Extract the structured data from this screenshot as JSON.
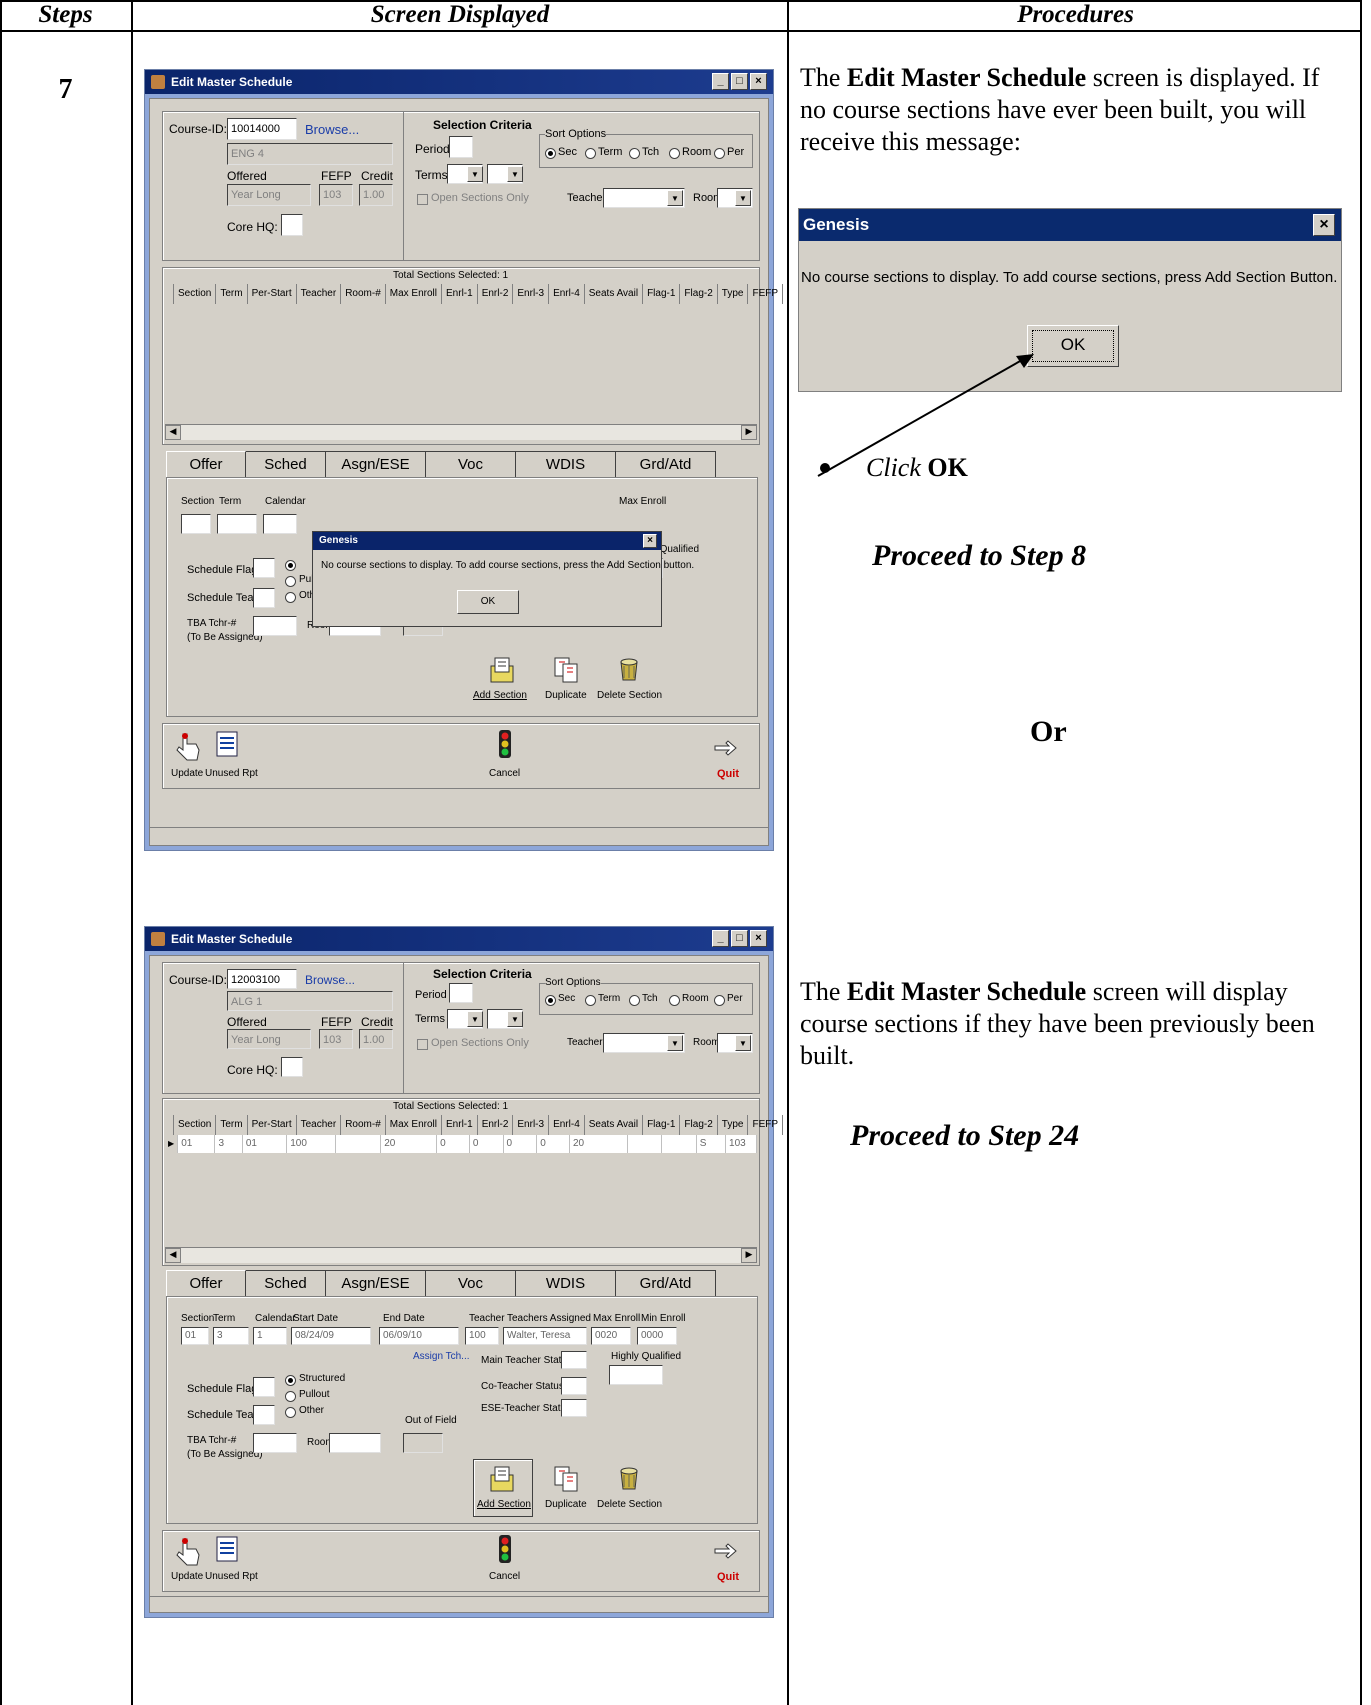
{
  "header": {
    "steps": "Steps",
    "screen": "Screen Displayed",
    "procedures": "Procedures"
  },
  "step_number": "7",
  "window_title": "Edit Master Schedule",
  "top_panel": {
    "course_id_label": "Course-ID:",
    "browse": "Browse...",
    "offered_label": "Offered",
    "fefp_label": "FEFP",
    "credit_label": "Credit",
    "core_hq_label": "Core HQ:",
    "selection_criteria": "Selection Criteria",
    "period_label": "Period",
    "terms_label": "Terms",
    "open_sections_only": "Open Sections Only",
    "sort_options": "Sort Options",
    "sort_sec": "Sec",
    "sort_term": "Term",
    "sort_tch": "Tch",
    "sort_room": "Room",
    "sort_per": "Per",
    "teacher_label": "Teacher",
    "room_label": "Room"
  },
  "grid_columns": [
    "Section",
    "Term",
    "Per-Start",
    "Teacher",
    "Room-#",
    "Max Enroll",
    "Enrl-1",
    "Enrl-2",
    "Enrl-3",
    "Enrl-4",
    "Seats Avail",
    "Flag-1",
    "Flag-2",
    "Type",
    "FEFP"
  ],
  "tabs": [
    "Offer",
    "Sched",
    "Asgn/ESE",
    "Voc",
    "WDIS",
    "Grd/Atd"
  ],
  "offer_panel": {
    "section": "Section",
    "term": "Term",
    "calendar": "Calendar",
    "start_date": "Start Date",
    "end_date": "End Date",
    "teacher": "Teacher",
    "teachers_assigned": "Teachers Assigned",
    "max_enroll": "Max Enroll",
    "min_enroll": "Min Enroll",
    "highly_qualified": "Highly Qualified",
    "assign_tch": "Assign Tch...",
    "main_teacher_status": "Main Teacher Status",
    "co_teacher_status": "Co-Teacher Status",
    "ese_teacher_status": "ESE-Teacher Status",
    "schedule_flag": "Schedule Flag",
    "schedule_team": "Schedule Team",
    "structured": "Structured",
    "pullout": "Pullout",
    "other": "Other",
    "out_of_field": "Out of Field",
    "tba_tchr": "TBA Tchr-#",
    "to_be_assigned": "(To Be Assigned)",
    "room": "Room",
    "add_section": "Add Section",
    "duplicate": "Duplicate",
    "delete_section": "Delete Section"
  },
  "bottom_bar": {
    "update": "Update",
    "unused_rpt": "Unused Rpt",
    "cancel": "Cancel",
    "quit": "Quit"
  },
  "screen1": {
    "course_id": "10014000",
    "course_name": "ENG 4",
    "offered": "Year Long",
    "fefp": "103",
    "credit": "1.00",
    "total_sections": "Total Sections Selected: 1",
    "dialog_title": "Genesis",
    "dialog_message": "No course sections to display.  To add course sections, press the Add Section button.",
    "dialog_ok": "OK"
  },
  "screen2": {
    "course_id": "12003100",
    "course_name": "ALG 1",
    "offered": "Year Long",
    "fefp": "103",
    "credit": "1.00",
    "total_sections": "Total Sections Selected: 1",
    "row": [
      "01",
      "3",
      "01",
      "100",
      "",
      "20",
      "0",
      "0",
      "0",
      "0",
      "20",
      "",
      "",
      "S",
      "103"
    ],
    "section": "01",
    "term": "3",
    "calendar": "1",
    "start_date": "08/24/09",
    "end_date": "06/09/10",
    "teacher": "100",
    "teachers_assigned": "Walter, Teresa",
    "max_enroll": "0020",
    "min_enroll": "0000"
  },
  "zoom_dialog": {
    "title": "Genesis",
    "message": "No course sections to display.  To add course sections, press Add Section Button.",
    "ok": "OK"
  },
  "procedures": {
    "p1_pre": "The ",
    "p1_bold": "Edit Master Schedule",
    "p1_post": " screen is displayed. If no course sections have ever been built, you will receive this message:",
    "click_word": "Click",
    "click_target": "OK",
    "proceed8": "Proceed to Step 8",
    "or": "Or",
    "p2_pre": "The ",
    "p2_bold": "Edit Master Schedule",
    "p2_post": " screen will display course sections if they have been previously been built.",
    "proceed24": "Proceed to Step 24"
  }
}
